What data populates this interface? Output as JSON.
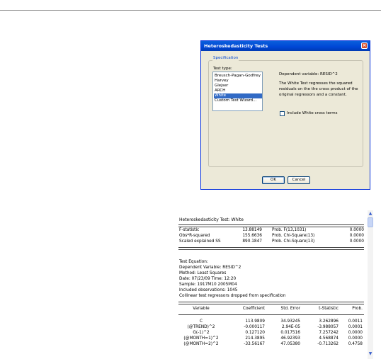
{
  "dialog": {
    "title": "Heteroskedasticity Tests",
    "group_label": "Specification",
    "test_type_label": "Test type:",
    "test_types": [
      "Breusch-Pagan-Godfrey",
      "Harvey",
      "Glejser",
      "ARCH",
      "White",
      "Custom Test Wizard..."
    ],
    "selected_test": "White",
    "dependent_variable": "Dependent variable: RESID^2",
    "description": "The White Test regresses the squared residuals on the the cross product of the original regressors and a constant.",
    "checkbox_label": "Include White cross terms",
    "checkbox_checked": false,
    "ok_label": "OK",
    "cancel_label": "Cancel"
  },
  "output": {
    "title": "Heteroskedasticity Test: White",
    "stats": [
      {
        "name": "F-statistic",
        "value": "13.88149",
        "prob_label": "Prob. F(13,1031)",
        "prob": "0.0000"
      },
      {
        "name": "Obs*R-squared",
        "value": "155.6636",
        "prob_label": "Prob. Chi-Square(13)",
        "prob": "0.0000"
      },
      {
        "name": "Scaled explained SS",
        "value": "890.1847",
        "prob_label": "Prob. Chi-Square(13)",
        "prob": "0.0000"
      }
    ],
    "equation_info": [
      "Test Equation:",
      "Dependent Variable: RESID^2",
      "Method: Least Squares",
      "Date: 07/23/09   Time: 12:20",
      "Sample: 1917M10 2005M04",
      "Included observations: 1045",
      "Collinear test regressors dropped from specification"
    ],
    "columns": [
      "Variable",
      "Coefficient",
      "Std. Error",
      "t-Statistic",
      "Prob."
    ],
    "rows": [
      [
        "C",
        "113.9809",
        "34.93245",
        "3.262896",
        "0.0011"
      ],
      [
        "(@TREND)^2",
        "-0.000117",
        "2.94E-05",
        "-3.988057",
        "0.0001"
      ],
      [
        "G(-1)^2",
        "0.127120",
        "0.017516",
        "7.257242",
        "0.0000"
      ],
      [
        "(@MONTH=1)^2",
        "214.3895",
        "46.92393",
        "4.568874",
        "0.0000"
      ],
      [
        "(@MONTH=2)^2",
        "-33.56167",
        "47.05380",
        "-0.713262",
        "0.4758"
      ]
    ]
  },
  "scrollbar": {
    "up_icon": "▲",
    "down_icon": "▼"
  }
}
